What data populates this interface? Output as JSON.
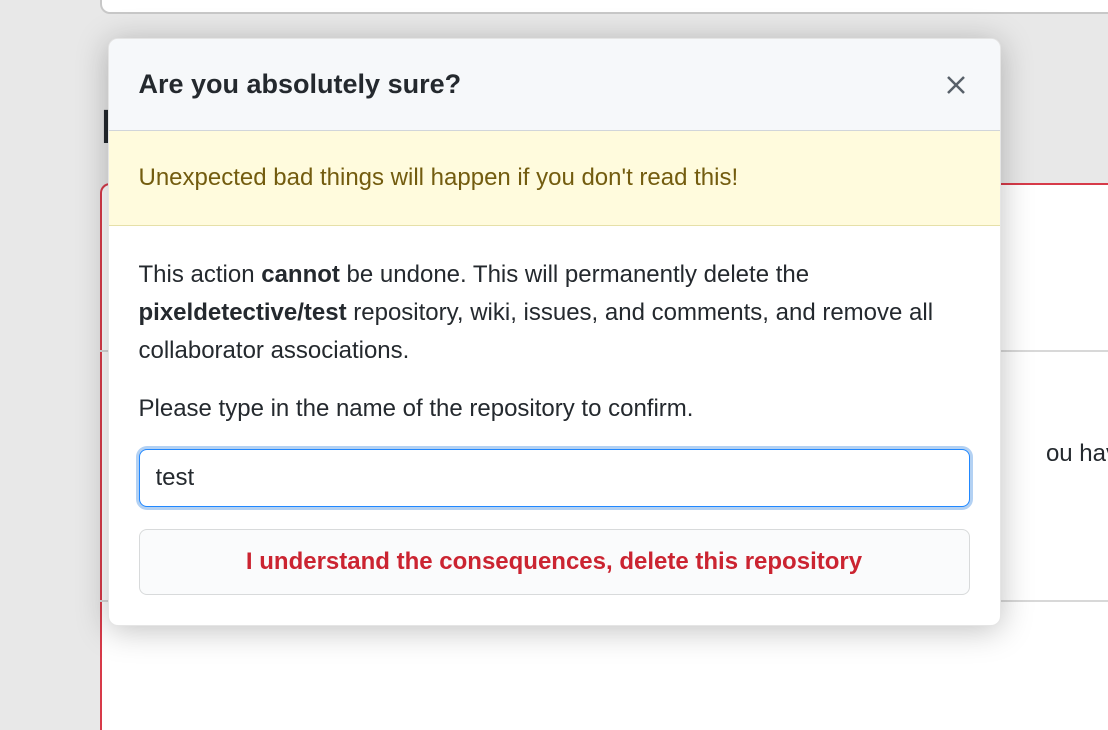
{
  "background": {
    "heading_letter": "D",
    "partial_text": "ou hav"
  },
  "modal": {
    "title": "Are you absolutely sure?",
    "warning": "Unexpected bad things will happen if you don't read this!",
    "description_prefix": "This action ",
    "description_cannot": "cannot",
    "description_mid": " be undone. This will permanently delete the ",
    "repo_name": "pixeldetective/test",
    "description_suffix": " repository, wiki, issues, and comments, and remove all collaborator associations.",
    "instruction": "Please type in the name of the repository to confirm.",
    "input_value": "test",
    "confirm_label": "I understand the consequences, delete this repository"
  }
}
